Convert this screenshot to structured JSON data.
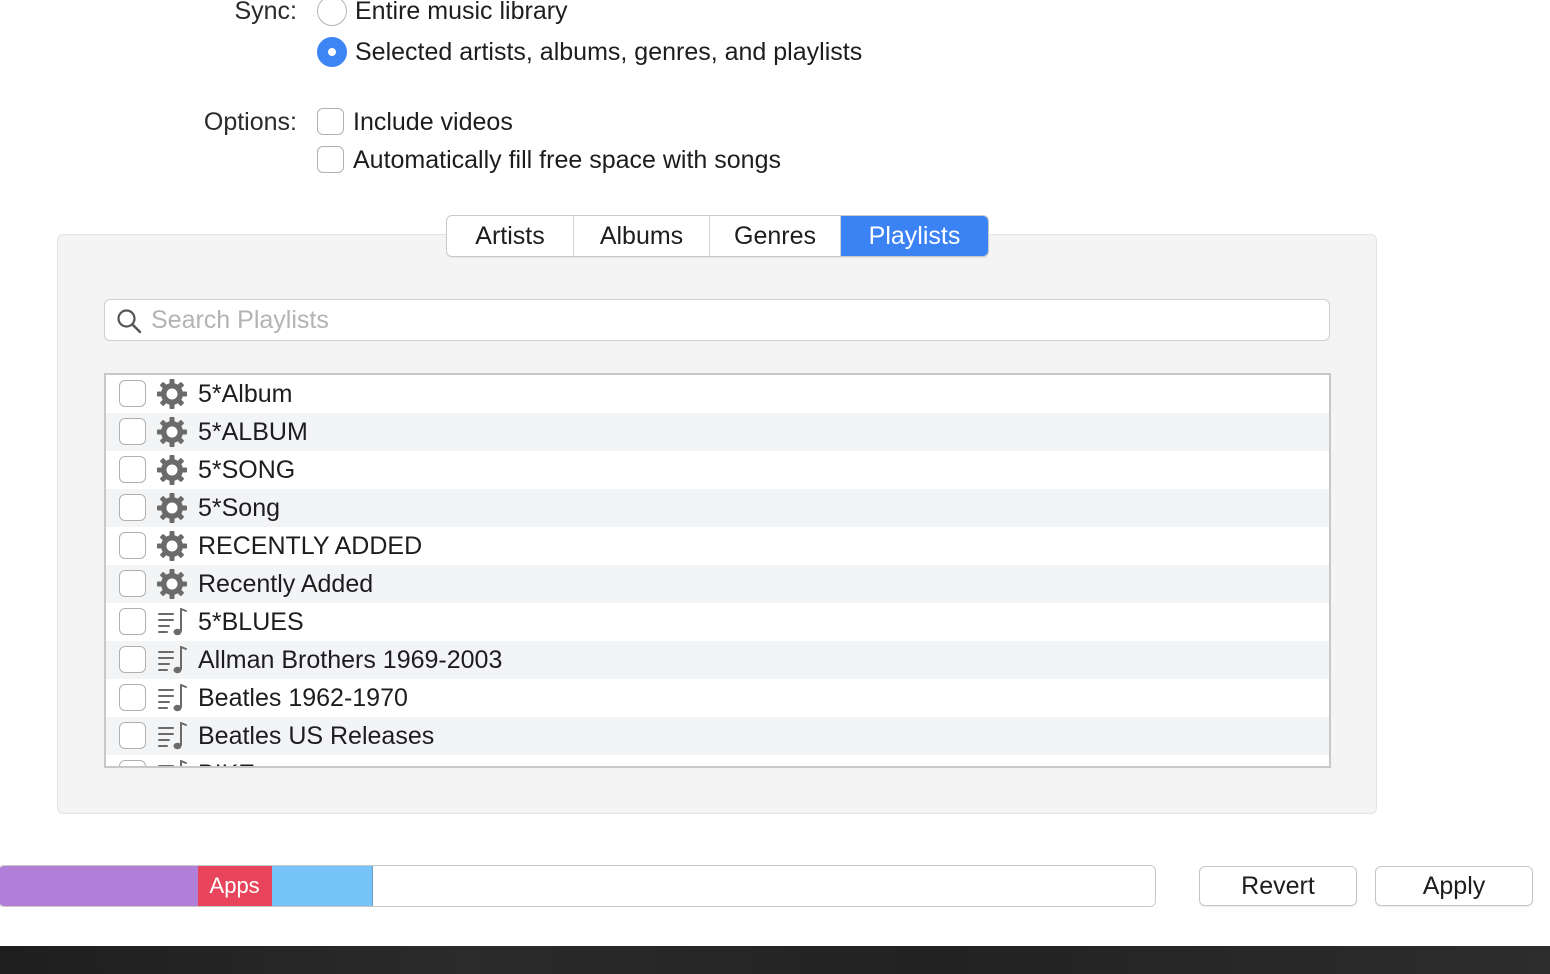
{
  "sync": {
    "label": "Sync:",
    "options": [
      {
        "label": "Entire music library",
        "selected": false
      },
      {
        "label": "Selected artists, albums, genres, and playlists",
        "selected": true
      }
    ]
  },
  "options": {
    "label": "Options:",
    "items": [
      {
        "label": "Include videos",
        "checked": false
      },
      {
        "label": "Automatically fill free space with songs",
        "checked": false
      }
    ]
  },
  "tabs": [
    {
      "label": "Artists",
      "active": false
    },
    {
      "label": "Albums",
      "active": false
    },
    {
      "label": "Genres",
      "active": false
    },
    {
      "label": "Playlists",
      "active": true
    }
  ],
  "search": {
    "placeholder": "Search Playlists"
  },
  "playlists": [
    {
      "name": "5*Album",
      "icon": "smart-playlist-gear-icon",
      "checked": false
    },
    {
      "name": "5*ALBUM",
      "icon": "smart-playlist-gear-icon",
      "checked": false
    },
    {
      "name": "5*SONG",
      "icon": "smart-playlist-gear-icon",
      "checked": false
    },
    {
      "name": "5*Song",
      "icon": "smart-playlist-gear-icon",
      "checked": false
    },
    {
      "name": "RECENTLY ADDED",
      "icon": "smart-playlist-gear-icon",
      "checked": false
    },
    {
      "name": "Recently Added",
      "icon": "smart-playlist-gear-icon",
      "checked": false
    },
    {
      "name": "5*BLUES",
      "icon": "playlist-music-icon",
      "checked": false
    },
    {
      "name": "Allman Brothers 1969-2003",
      "icon": "playlist-music-icon",
      "checked": false
    },
    {
      "name": "Beatles 1962-1970",
      "icon": "playlist-music-icon",
      "checked": false
    },
    {
      "name": "Beatles US Releases",
      "icon": "playlist-music-icon",
      "checked": false
    },
    {
      "name": "BIKE",
      "icon": "playlist-music-icon",
      "checked": false
    }
  ],
  "capacity": {
    "segments": [
      {
        "label": "",
        "color": "#b27fd8",
        "fraction": 0.172
      },
      {
        "label": "Apps",
        "color": "#e8455c",
        "fraction": 0.064
      },
      {
        "label": "",
        "color": "#76c4f8",
        "fraction": 0.087
      },
      {
        "label": "",
        "color": "#ffffff",
        "fraction": 0.677
      }
    ]
  },
  "buttons": {
    "revert": "Revert",
    "apply": "Apply"
  },
  "colors": {
    "accent": "#3b82f4"
  }
}
